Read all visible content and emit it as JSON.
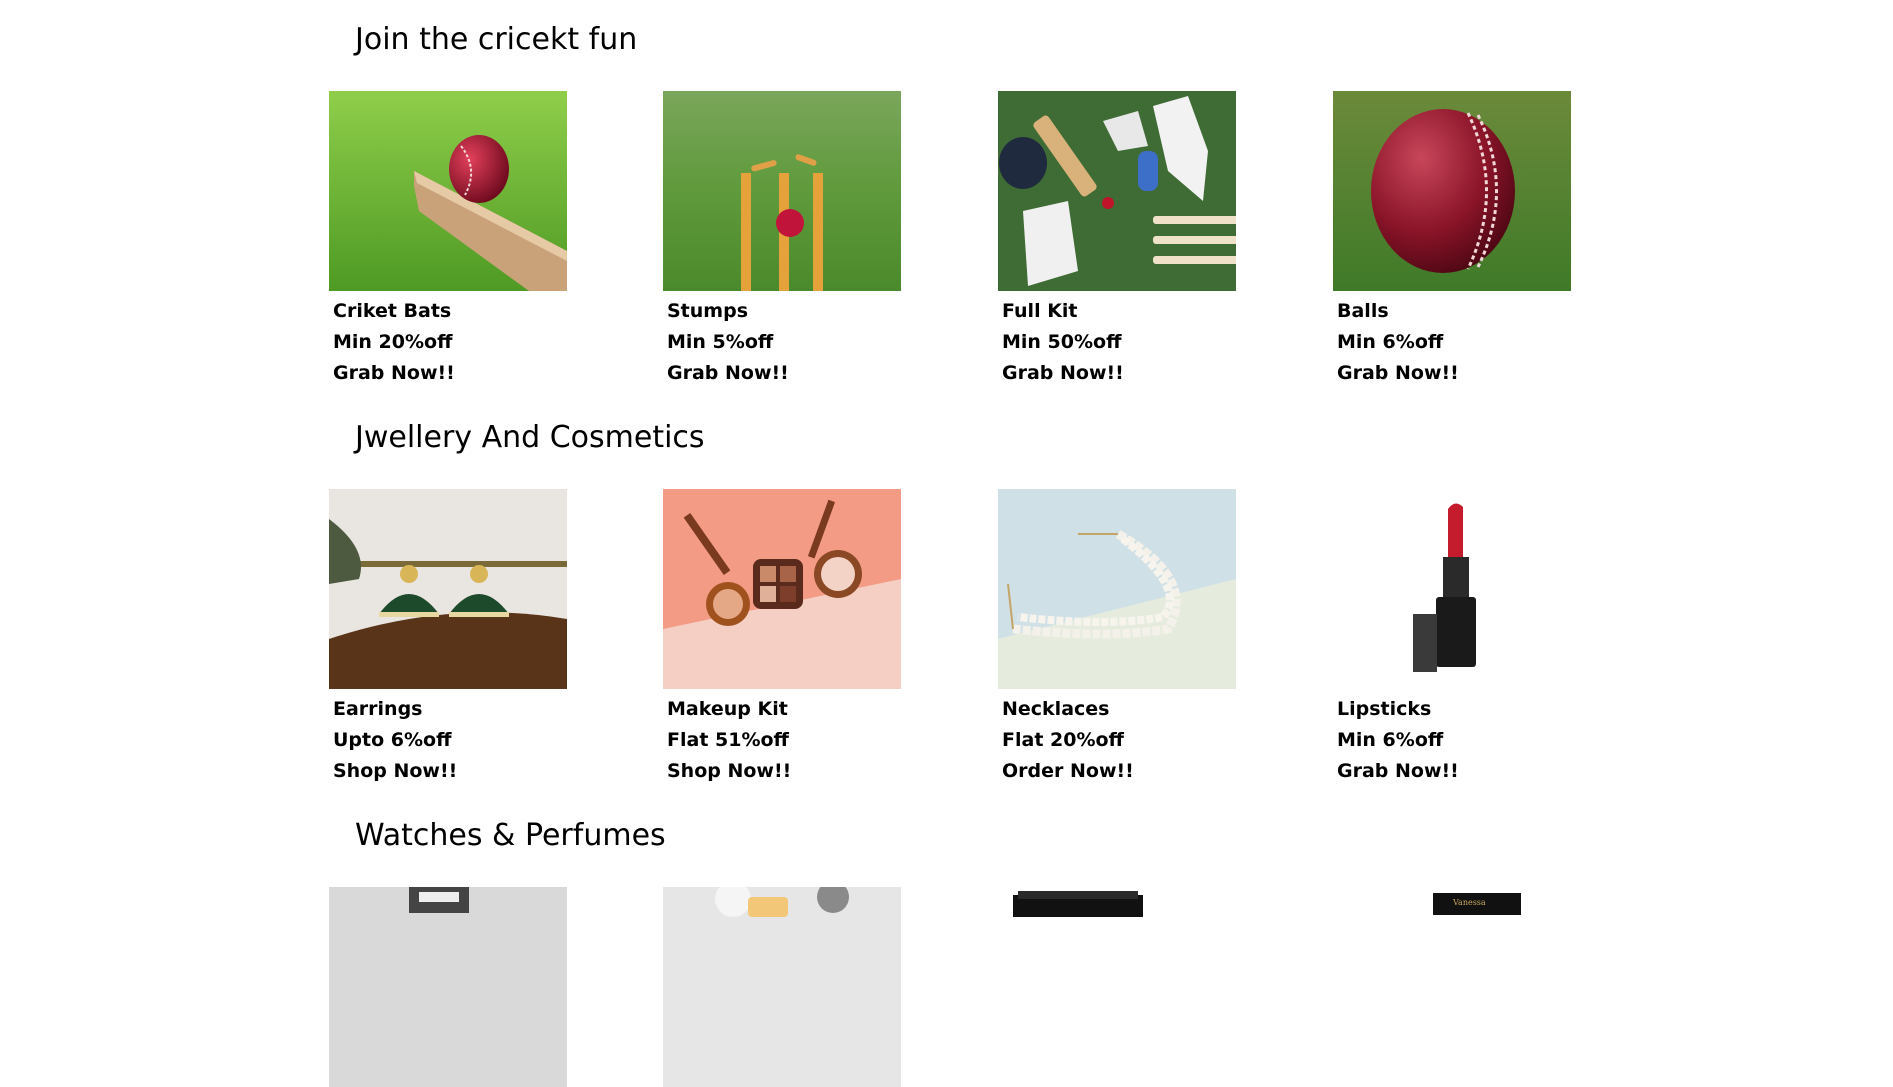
{
  "sections": [
    {
      "title": "Join the cricekt fun",
      "items": [
        {
          "name": "Criket Bats",
          "offer": "Min 20%off",
          "cta": "Grab Now!!",
          "image": "cricket-ball-on-bat-image"
        },
        {
          "name": "Stumps",
          "offer": "Min 5%off",
          "cta": "Grab Now!!",
          "image": "ball-hitting-stumps-image"
        },
        {
          "name": "Full Kit",
          "offer": "Min 50%off",
          "cta": "Grab Now!!",
          "image": "cricket-kit-flatlay-image"
        },
        {
          "name": "Balls",
          "offer": "Min 6%off",
          "cta": "Grab Now!!",
          "image": "red-cricket-ball-image"
        }
      ]
    },
    {
      "title": "Jwellery And Cosmetics",
      "items": [
        {
          "name": "Earrings",
          "offer": "Upto 6%off",
          "cta": "Shop Now!!",
          "image": "jhumka-earrings-image"
        },
        {
          "name": "Makeup Kit",
          "offer": "Flat 51%off",
          "cta": "Shop Now!!",
          "image": "makeup-kit-image"
        },
        {
          "name": "Necklaces",
          "offer": "Flat 20%off",
          "cta": "Order Now!!",
          "image": "pearl-necklace-image"
        },
        {
          "name": "Lipsticks",
          "offer": "Min 6%off",
          "cta": "Grab Now!!",
          "image": "red-lipstick-image"
        }
      ]
    },
    {
      "title": "Watches & Perfumes",
      "items": [
        {
          "image": "watch-image"
        },
        {
          "image": "perfume-splash-image"
        },
        {
          "image": "black-box-image"
        },
        {
          "image": "perfume-box-image",
          "label": "Vanessa"
        }
      ]
    }
  ]
}
